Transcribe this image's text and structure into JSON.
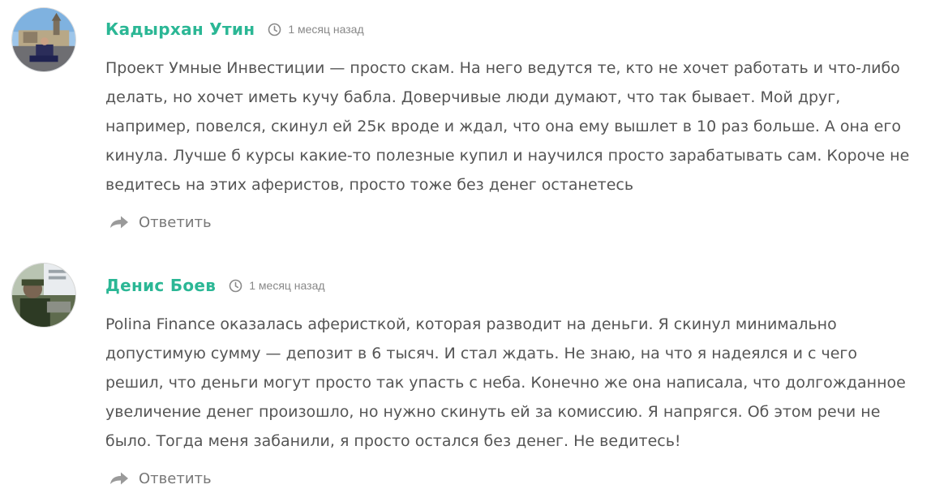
{
  "colors": {
    "author": "#2bb795",
    "text": "#555555",
    "meta": "#888888",
    "reply": "#777777",
    "reply_icon": "#9a9a9a"
  },
  "comments": [
    {
      "author": "Кадырхан Утин",
      "time": "1 месяц назад",
      "time_icon": "clock-icon",
      "text": "Проект Умные Инвестиции — просто скам. На него ведутся те, кто не хочет работать и что-либо делать, но хочет иметь кучу бабла. Доверчивые люди думают, что так бывает. Мой друг, например, повелся, скинул ей 25к вроде и ждал, что она ему вышлет в 10 раз больше. А она его кинула. Лучше б курсы какие-то полезные купил и научился просто зарабатывать сам. Короче не ведитесь на этих аферистов, просто тоже без денег останетесь",
      "reply_label": "Ответить",
      "reply_icon": "reply-arrow-icon"
    },
    {
      "author": "Денис Боев",
      "time": "1 месяц назад",
      "time_icon": "clock-icon",
      "text": "Polina Finance оказалась аферисткой, которая разводит на деньги. Я скинул минимально допустимую сумму — депозит в 6 тысяч. И стал ждать. Не знаю, на что я надеялся и с чего решил, что деньги могут просто так упасть с неба. Конечно же она написала, что долгожданное увеличение денег произошло, но нужно скинуть ей за комиссию. Я напрягся. Об этом речи не было. Тогда меня забанили, я просто остался без денег. Не ведитесь!",
      "reply_label": "Ответить",
      "reply_icon": "reply-arrow-icon"
    }
  ]
}
